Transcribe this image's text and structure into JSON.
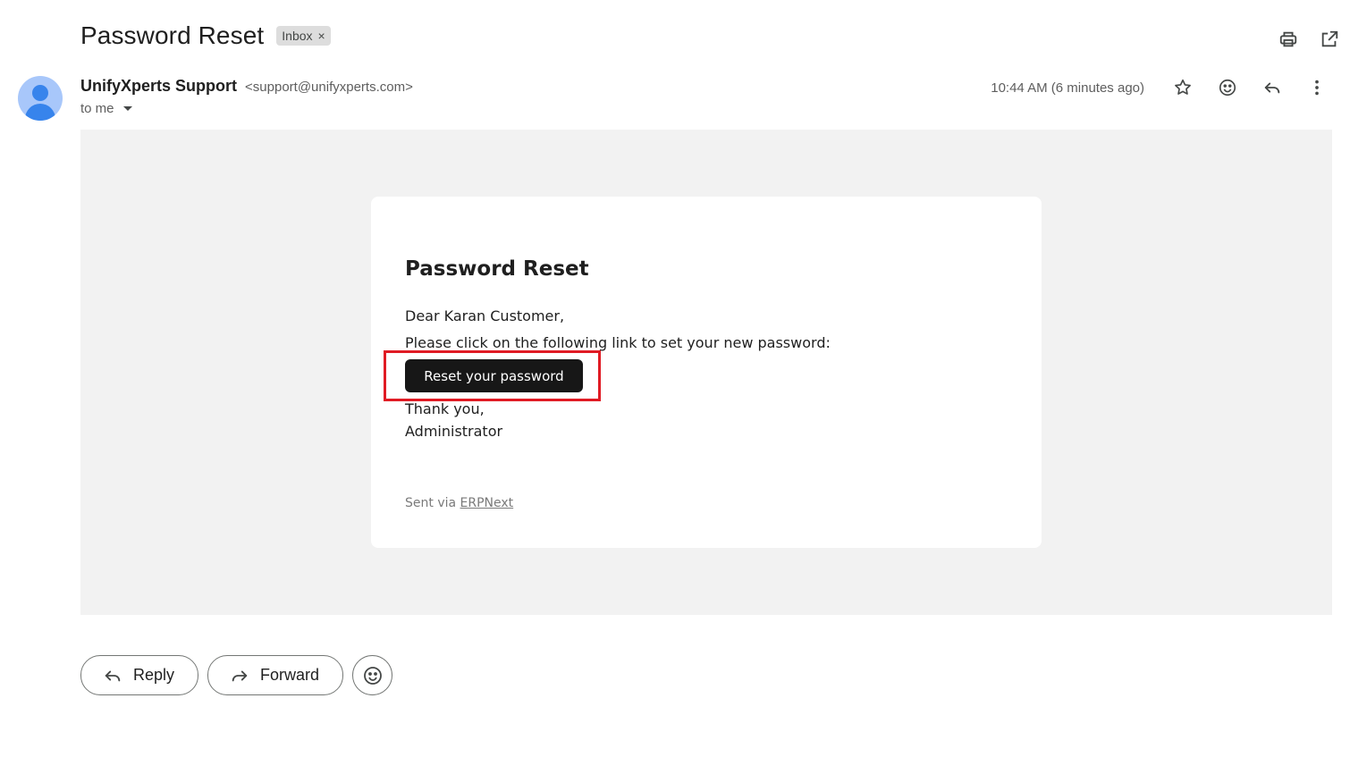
{
  "message": {
    "subject": "Password Reset",
    "label_chip": {
      "label": "Inbox",
      "remove_glyph": "×"
    }
  },
  "top_actions": [
    {
      "icon": "print-icon"
    },
    {
      "icon": "open-in-new-window-icon"
    }
  ],
  "sender": {
    "name": "UnifyXperts Support",
    "email": "<support@unifyxperts.com>",
    "recipient_text": "to me"
  },
  "meta": {
    "timestamp": "10:44 AM (6 minutes ago)",
    "actions": [
      "star-icon",
      "emoji-react-icon",
      "reply-icon",
      "more-vert-icon"
    ]
  },
  "email_body": {
    "title": "Password Reset",
    "greeting": "Dear Karan Customer,",
    "instruction": "Please click on the following link to set your new password:",
    "button_label": "Reset your password",
    "thanks": "Thank you,",
    "signoff": "Administrator",
    "sent_via_prefix": "Sent via ",
    "sent_via_link": "ERPNext"
  },
  "bottom_actions": {
    "reply_label": "Reply",
    "forward_label": "Forward"
  },
  "colors": {
    "highlight": "#e01b24",
    "button_bg": "#171717",
    "frame_bg": "#f2f2f2",
    "avatar_bg": "#a8c7fa"
  }
}
